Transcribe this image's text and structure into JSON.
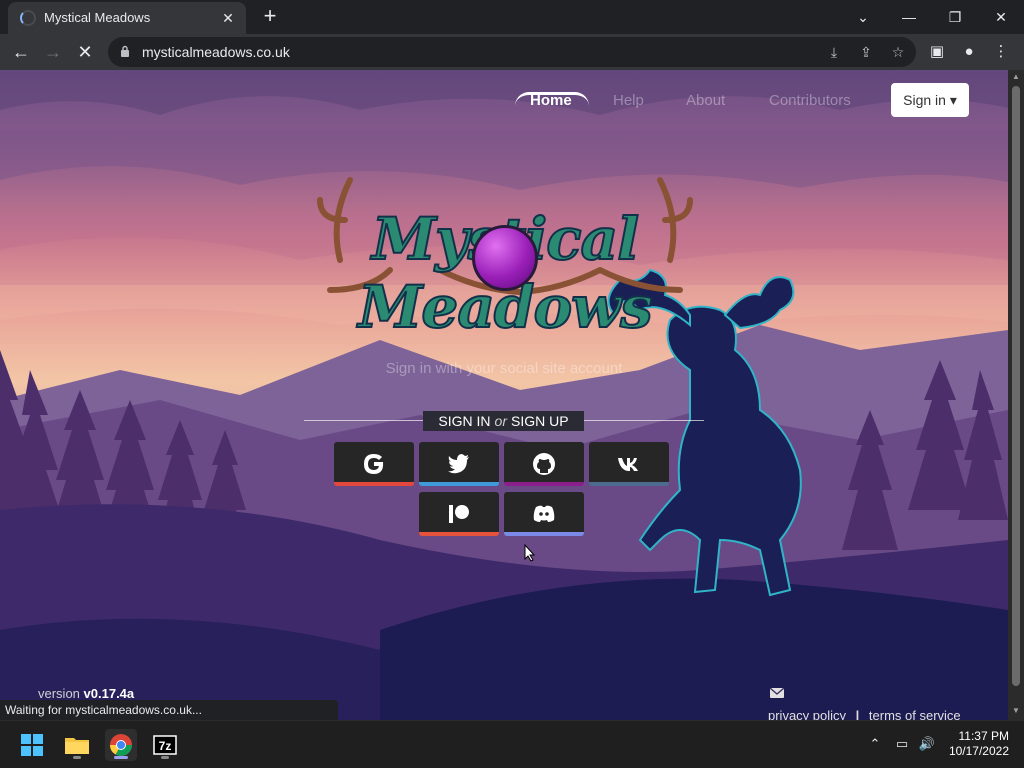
{
  "browser": {
    "tab_title": "Mystical Meadows",
    "tab_close": "✕",
    "new_tab": "+",
    "url": "mysticalmeadows.co.uk",
    "window_controls": {
      "minimize": "—",
      "maximize": "❐",
      "close": "✕",
      "tab_search": "⌄"
    },
    "status_text": "Waiting for mysticalmeadows.co.uk..."
  },
  "site": {
    "logo_text": "Mystical Meadows",
    "nav": {
      "home": "Home",
      "help": "Help",
      "about": "About",
      "contributors": "Contributors",
      "signin": "Sign in ▾"
    },
    "subtitle": "Sign in with your social site account",
    "signin_label": {
      "sign_in": "SIGN IN",
      "or": "or",
      "sign_up": "SIGN UP"
    },
    "social_buttons": [
      {
        "name": "google",
        "color": "#e4473b"
      },
      {
        "name": "twitter",
        "color": "#3e9ad8"
      },
      {
        "name": "github",
        "color": "#8a1e8a"
      },
      {
        "name": "vk",
        "color": "#4d6b8f"
      },
      {
        "name": "patreon",
        "color": "#e5533c"
      },
      {
        "name": "discord",
        "color": "#7b8ae6"
      }
    ],
    "footer": {
      "version_prefix": "version ",
      "version": "v0.17.4a",
      "privacy": "privacy policy",
      "separator": "|",
      "terms": "terms of service"
    }
  },
  "taskbar": {
    "time": "11:37 PM",
    "date": "10/17/2022"
  }
}
